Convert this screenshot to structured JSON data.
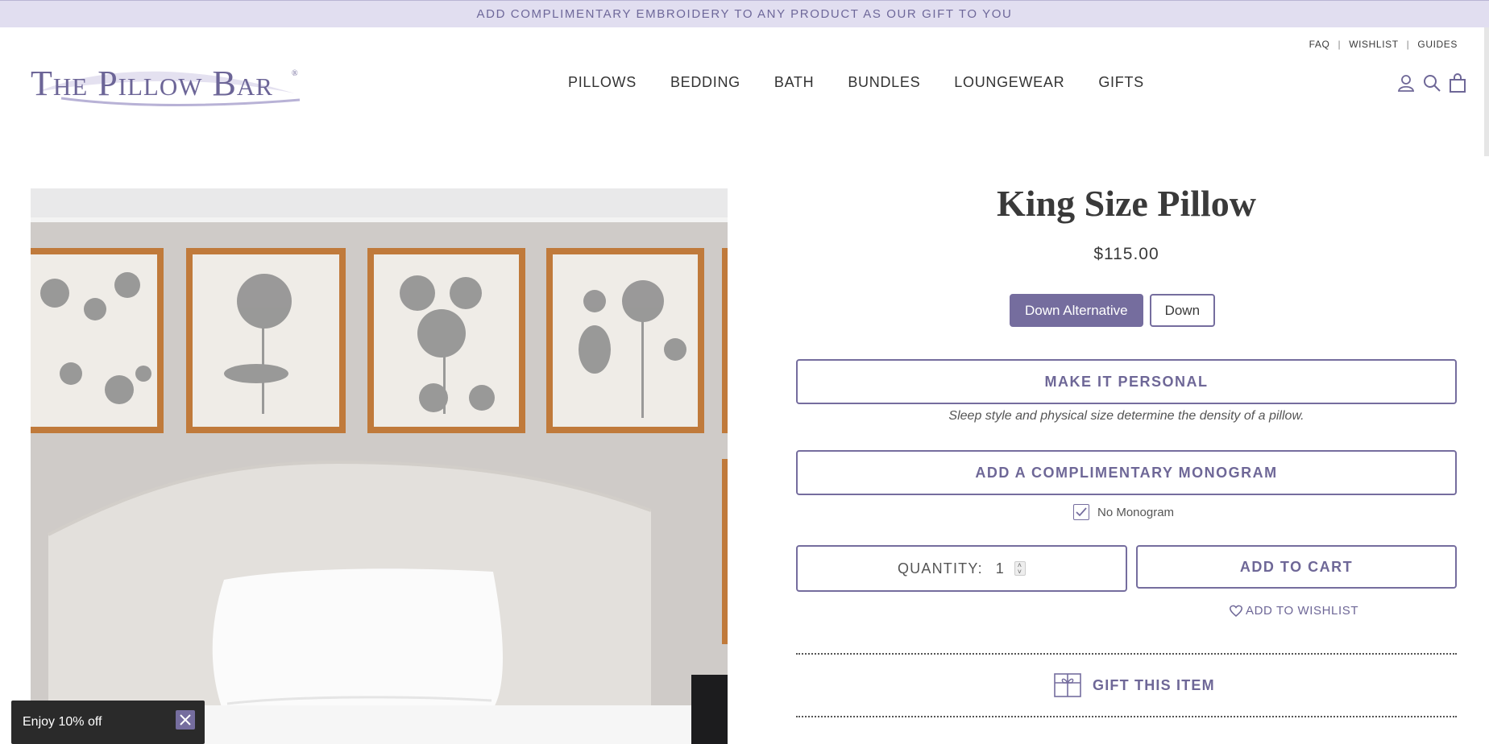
{
  "announcement": {
    "text": "ADD COMPLIMENTARY EMBROIDERY TO ANY PRODUCT AS OUR GIFT TO YOU"
  },
  "utility_links": [
    {
      "label": "FAQ"
    },
    {
      "label": "WISHLIST"
    },
    {
      "label": "GUIDES"
    }
  ],
  "logo": {
    "text": "The Pillow Bar",
    "reg": "®"
  },
  "nav": [
    {
      "label": "PILLOWS"
    },
    {
      "label": "BEDDING"
    },
    {
      "label": "BATH"
    },
    {
      "label": "BUNDLES"
    },
    {
      "label": "LOUNGEWEAR"
    },
    {
      "label": "GIFTS"
    }
  ],
  "header_icons": [
    "account-icon",
    "search-icon",
    "cart-bag-icon"
  ],
  "product": {
    "title": "King Size Pillow",
    "price": "$115.00",
    "variants": [
      {
        "label": "Down Alternative",
        "selected": true
      },
      {
        "label": "Down",
        "selected": false
      }
    ],
    "personal_button": "MAKE IT PERSONAL",
    "note": "Sleep style and physical size determine the density of a pillow.",
    "monogram_button": "ADD A COMPLIMENTARY MONOGRAM",
    "no_monogram_label": "No Monogram",
    "no_monogram_checked": true,
    "quantity_label": "QUANTITY:",
    "quantity_value": "1",
    "add_to_cart": "ADD TO CART",
    "wishlist": "ADD TO WISHLIST",
    "gift_label": "GIFT THIS ITEM"
  },
  "popup": {
    "text": "Enjoy 10% off"
  },
  "colors": {
    "accent": "#756d9e",
    "announcement_bg": "#e1def0",
    "frame_gold": "#c07a3b"
  }
}
